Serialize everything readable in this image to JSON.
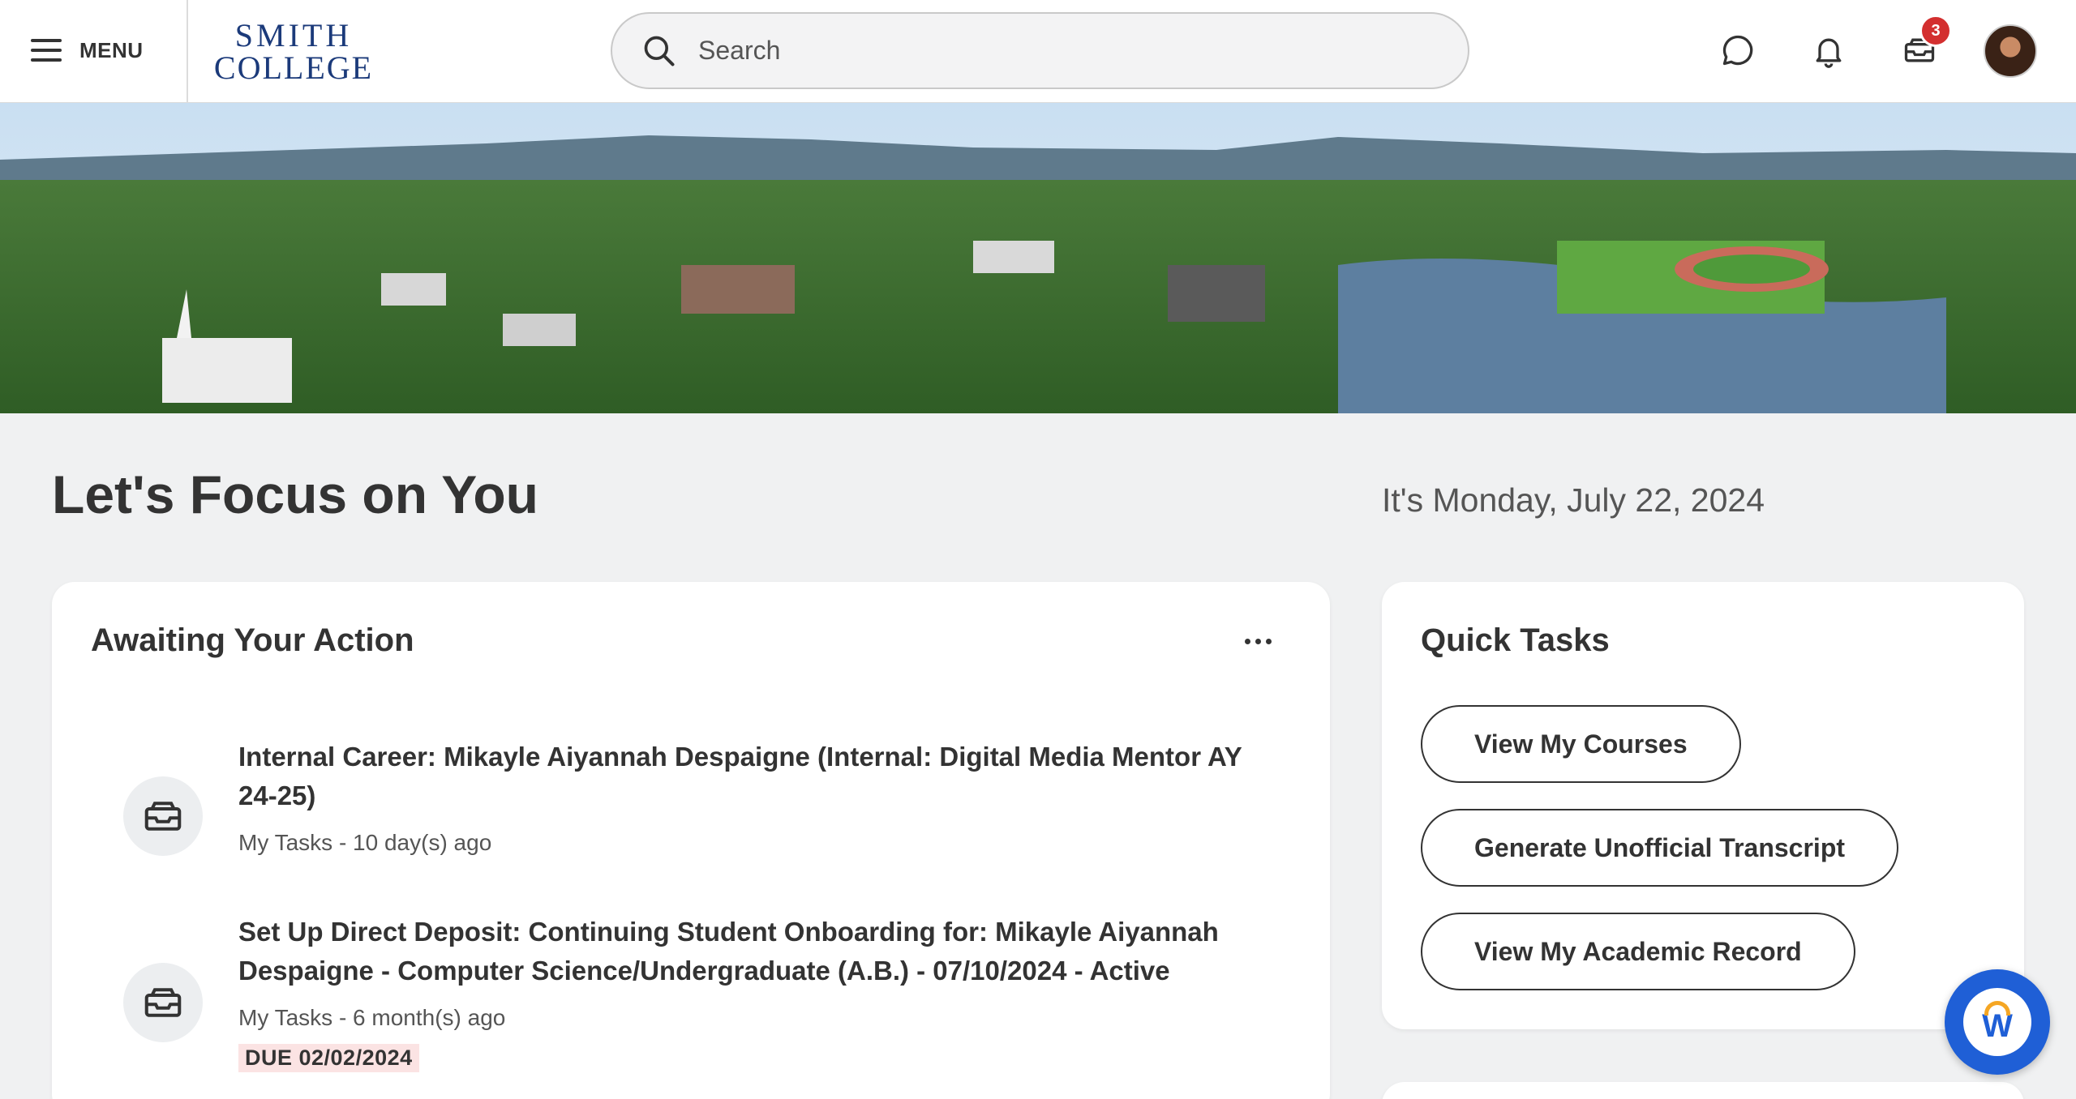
{
  "header": {
    "menu_label": "MENU",
    "logo_line1": "SMITH",
    "logo_line2": "COLLEGE",
    "search_placeholder": "Search",
    "inbox_badge": "3",
    "icons": [
      "hamburger-icon",
      "search-icon",
      "chat-icon",
      "bell-icon",
      "inbox-icon",
      "avatar"
    ]
  },
  "page": {
    "title": "Let's Focus on You",
    "date": "It's Monday, July 22, 2024"
  },
  "awaiting": {
    "title": "Awaiting Your Action",
    "items": [
      {
        "title": "Internal Career: Mikayle Aiyannah Despaigne (Internal: Digital Media Mentor AY 24-25)",
        "meta": "My Tasks - 10 day(s) ago",
        "due": ""
      },
      {
        "title": "Set Up Direct Deposit: Continuing Student Onboarding for: Mikayle Aiyannah Despaigne - Computer Science/Undergraduate (A.B.) - 07/10/2024 - Active",
        "meta": "My Tasks - 6 month(s) ago",
        "due": "DUE 02/02/2024"
      }
    ]
  },
  "quick_tasks": {
    "title": "Quick Tasks",
    "buttons": [
      "View My Courses",
      "Generate Unofficial Transcript",
      "View My Academic Record"
    ]
  },
  "colors": {
    "brand_blue": "#1b3a7a",
    "badge_red": "#d32f2f",
    "assistant_blue": "#1f5fd6",
    "due_bg": "#fbe3e3"
  }
}
